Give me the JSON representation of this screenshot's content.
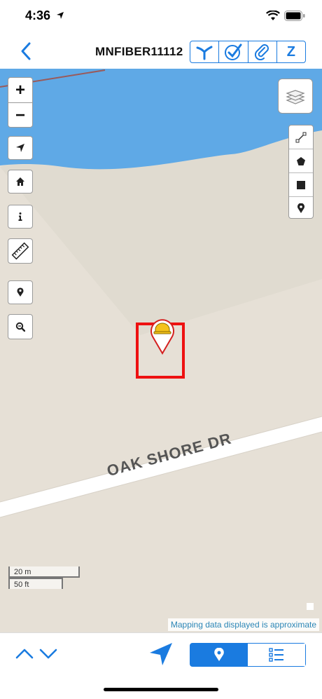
{
  "status_bar": {
    "time": "4:36"
  },
  "nav": {
    "title": "MNFIBER11112",
    "segment_last_label": "Z"
  },
  "map": {
    "street_label": "OAK SHORE DR",
    "scale_metric": "20 m",
    "scale_imperial": "50 ft",
    "attribution": "Mapping data displayed is approximate",
    "colors": {
      "water": "#5fa9e6",
      "land": "#e6e0d6",
      "marker_box": "#ee1111",
      "accent": "#1a7be0"
    }
  },
  "icons": [
    "back-chevron-icon",
    "location-arrow-icon",
    "check-circle-icon",
    "paperclip-icon",
    "layers-icon",
    "line-tool-icon",
    "polygon-tool-icon",
    "rectangle-tool-icon",
    "pin-tool-icon",
    "home-icon",
    "info-icon",
    "ruler-icon",
    "zoom-search-icon",
    "hard-hat-icon",
    "chevron-up-icon",
    "chevron-down-icon",
    "list-icon"
  ]
}
